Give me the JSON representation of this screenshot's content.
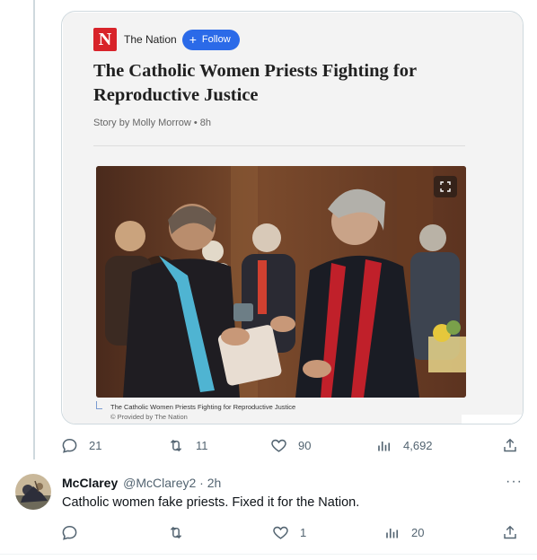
{
  "card": {
    "publisher": "The Nation",
    "publisher_logo_letter": "N",
    "follow_label": "Follow",
    "headline": "The Catholic Women Priests Fighting for Reproductive Justice",
    "byline": "Story by Molly Morrow • 8h",
    "photo_caption": "The Catholic Women Priests Fighting for Reproductive Justice",
    "photo_credit": "© Provided by The Nation"
  },
  "quoted_actions": {
    "replies": "21",
    "reposts": "11",
    "likes": "90",
    "views": "4,692"
  },
  "tweet": {
    "name": "McClarey",
    "handle": "@McClarey2 · 2h",
    "more": "···",
    "text": "Catholic women fake priests.  Fixed it for the Nation."
  },
  "tweet_actions": {
    "replies": "",
    "reposts": "",
    "likes": "1",
    "views": "20"
  },
  "colors": {
    "nation_red": "#d8232a",
    "follow_blue": "#2b6ae8",
    "icon_gray": "#536471"
  }
}
